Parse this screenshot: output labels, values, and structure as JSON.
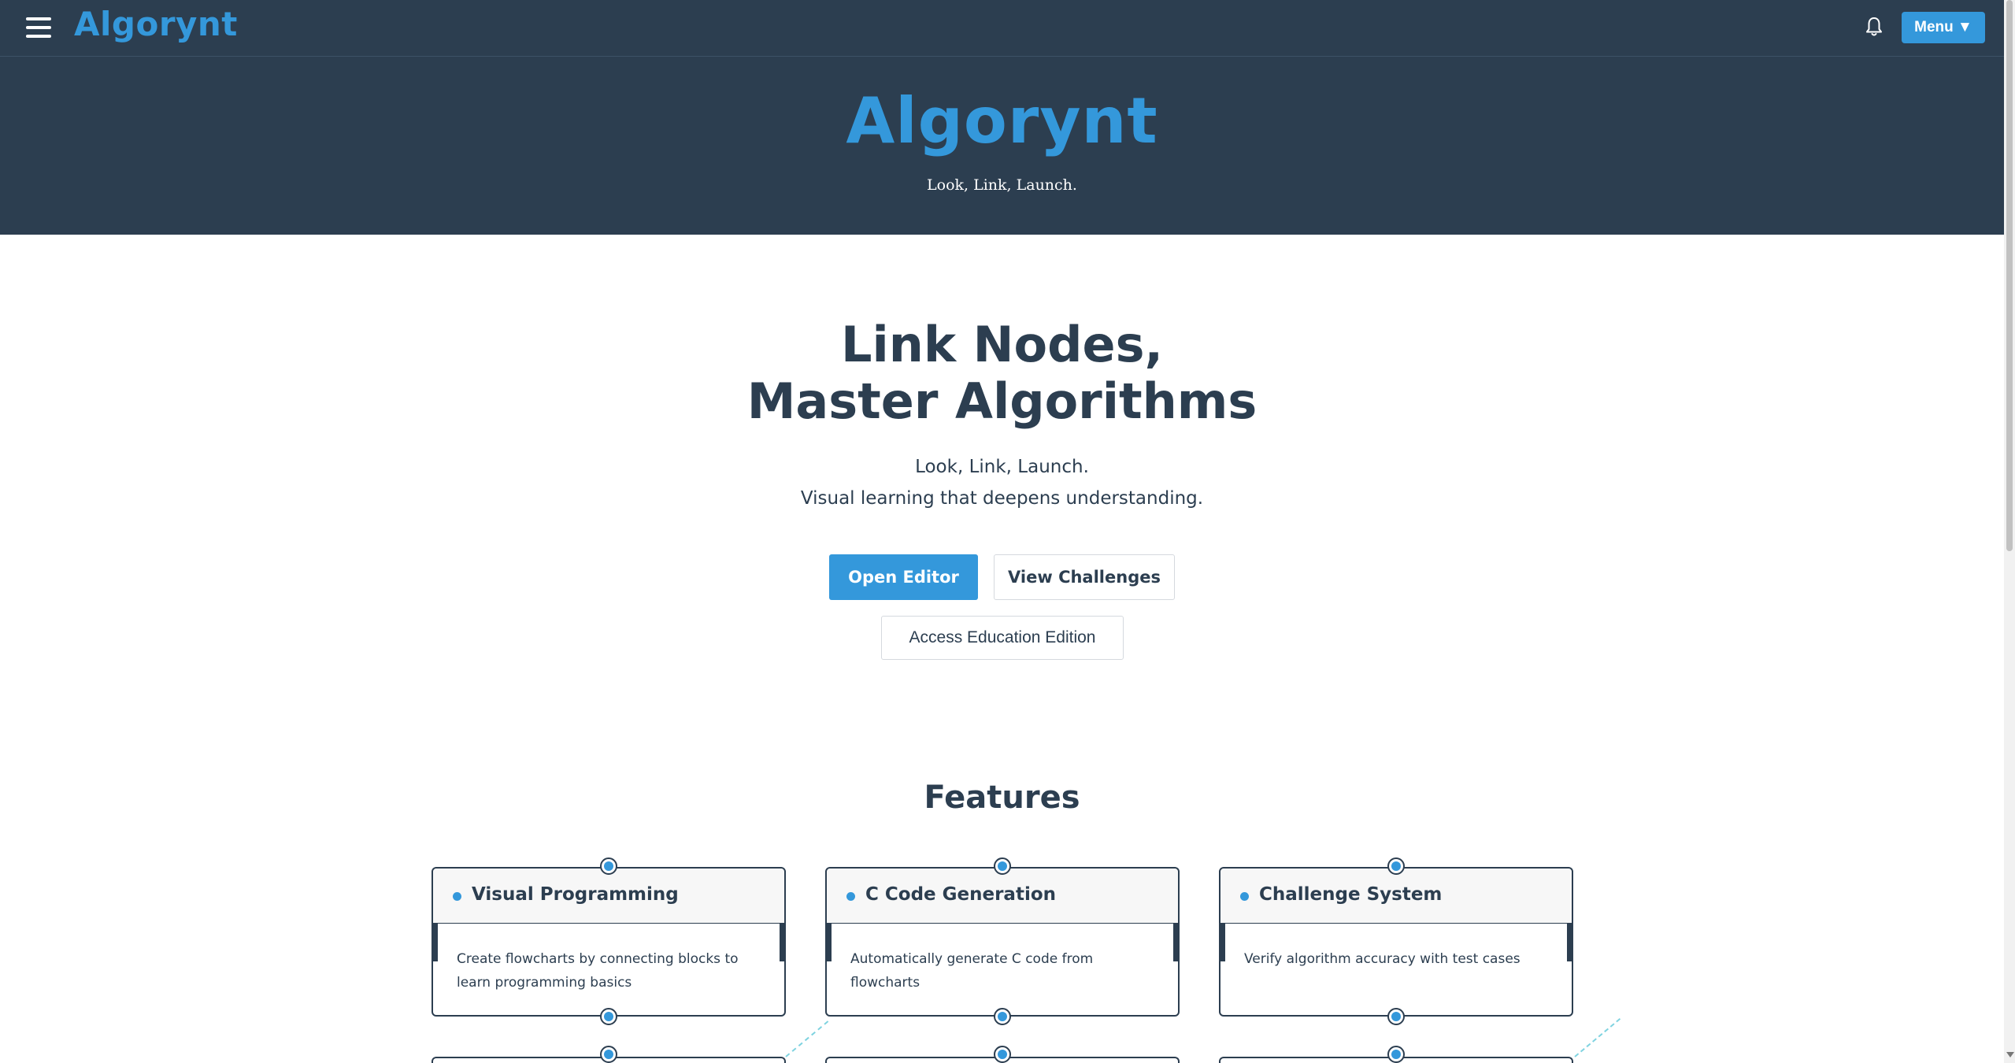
{
  "nav": {
    "brand": "Algorynt",
    "menu_button": "Menu ▼"
  },
  "hero": {
    "title": "Algorynt",
    "tagline": "Look, Link, Launch."
  },
  "main": {
    "headline_line1": "Link Nodes,",
    "headline_line2": "Master Algorithms",
    "subtitle_line1": "Look, Link, Launch.",
    "subtitle_line2": "Visual learning that deepens understanding.",
    "open_editor": "Open Editor",
    "view_challenges": "View Challenges",
    "education_edition": "Access Education Edition"
  },
  "features": {
    "title": "Features",
    "cards": [
      {
        "title": "Visual Programming",
        "description": "Create flowcharts by connecting blocks to learn programming basics"
      },
      {
        "title": "C Code Generation",
        "description": "Automatically generate C code from flowcharts"
      },
      {
        "title": "Challenge System",
        "description": "Verify algorithm accuracy with test cases"
      }
    ]
  },
  "colors": {
    "nav_bg": "#2c3e50",
    "accent": "#3498db",
    "text": "#2c3e50",
    "connector": "#7fd3e0"
  },
  "icons": {
    "hamburger": "hamburger-menu-icon",
    "bell": "bell-icon",
    "dot": "bullet-dot-icon",
    "port": "node-port-icon"
  }
}
